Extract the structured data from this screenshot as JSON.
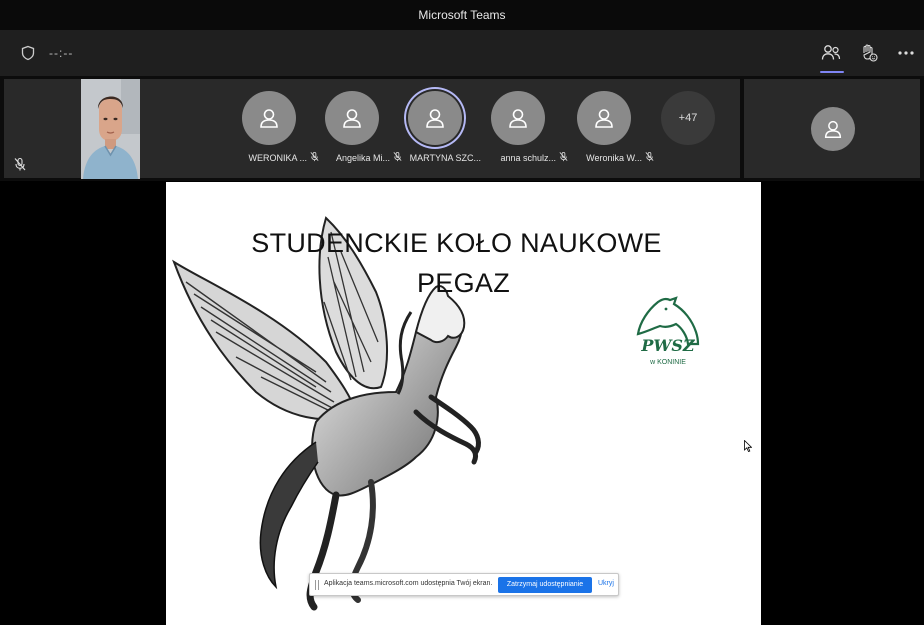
{
  "window": {
    "title": "Microsoft Teams"
  },
  "toolbar": {
    "timer": "--:--"
  },
  "participants": [
    {
      "name": "WERONIKA ...",
      "mic": "muted"
    },
    {
      "name": "Angelika Mi...",
      "mic": "muted"
    },
    {
      "name": "MARTYNA SZC...",
      "mic": "none",
      "speaking": true
    },
    {
      "name": "anna schulz...",
      "mic": "muted"
    },
    {
      "name": "Weronika W...",
      "mic": "muted"
    }
  ],
  "overflow": {
    "count": "+47"
  },
  "slide": {
    "title_line1": "STUDENCKIE KOŁO  NAUKOWE",
    "title_line2": "PEGAZ",
    "logo_text": "PWSZ",
    "logo_sub": "w KONINIE"
  },
  "share_bar": {
    "message": "Aplikacja teams.microsoft.com udostępnia Twój ekran.",
    "stop_label": "Zatrzymaj udostępnianie",
    "hide_label": "Ukryj"
  },
  "colors": {
    "accent": "#7f85f5",
    "logo_green": "#1f6b45",
    "share_blue": "#1a73e8"
  }
}
